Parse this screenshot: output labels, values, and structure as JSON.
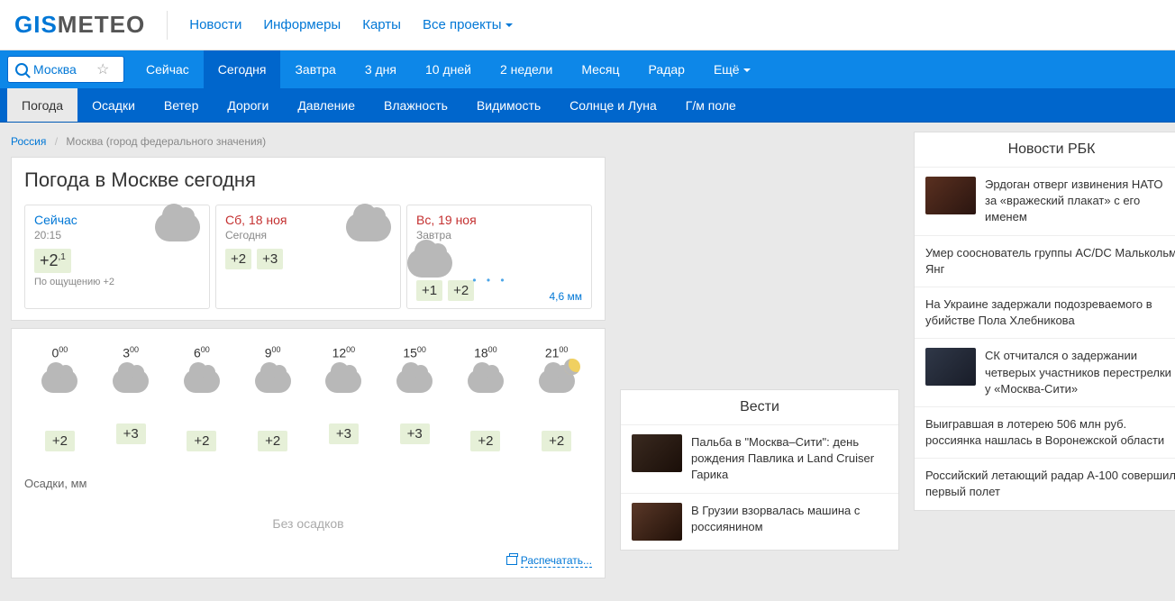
{
  "header": {
    "logo_gis": "GIS",
    "logo_meteo": "METEO",
    "nav": [
      "Новости",
      "Информеры",
      "Карты",
      "Все проекты"
    ]
  },
  "search": {
    "value": "Москва"
  },
  "nav_tabs": [
    "Сейчас",
    "Сегодня",
    "Завтра",
    "3 дня",
    "10 дней",
    "2 недели",
    "Месяц",
    "Радар",
    "Ещё"
  ],
  "nav_active": 1,
  "sub_nav": [
    "Погода",
    "Осадки",
    "Ветер",
    "Дороги",
    "Давление",
    "Влажность",
    "Видимость",
    "Солнце и Луна",
    "Г/м поле"
  ],
  "sub_nav_active": 0,
  "breadcrumb": {
    "country": "Россия",
    "city": "Москва (город федерального значения)"
  },
  "title": "Погода в Москве сегодня",
  "summary": [
    {
      "title": "Сейчас",
      "sub": "20:15",
      "temp": "+2",
      "temp_dec": ",1",
      "feel": "По ощущению +2"
    },
    {
      "title": "Сб, 18 ноя",
      "sub": "Сегодня",
      "temps": [
        "+2",
        "+3"
      ]
    },
    {
      "title": "Вс, 19 ноя",
      "sub": "Завтра",
      "temps": [
        "+1",
        "+2"
      ],
      "precip": "4,6 мм"
    }
  ],
  "hours": [
    {
      "h": "0",
      "m": "00",
      "temp": "+2"
    },
    {
      "h": "3",
      "m": "00",
      "temp": "+3"
    },
    {
      "h": "6",
      "m": "00",
      "temp": "+2"
    },
    {
      "h": "9",
      "m": "00",
      "temp": "+2"
    },
    {
      "h": "12",
      "m": "00",
      "temp": "+3"
    },
    {
      "h": "15",
      "m": "00",
      "temp": "+3"
    },
    {
      "h": "18",
      "m": "00",
      "temp": "+2"
    },
    {
      "h": "21",
      "m": "00",
      "temp": "+2"
    }
  ],
  "precip_label": "Осадки, мм",
  "precip_empty": "Без осадков",
  "print": "Распечатать...",
  "vesti": {
    "title": "Вести",
    "items": [
      "Пальба в \"Москва–Сити\": день рождения Павлика и Land Cruiser Гарика",
      "В Грузии взорвалась машина с россиянином"
    ]
  },
  "rbc": {
    "title": "Новости РБК",
    "items": [
      {
        "thumb": true,
        "text": "Эрдоган отверг извинения НАТО за «вражеский плакат» с его именем"
      },
      {
        "thumb": false,
        "text": "Умер сооснователь группы AC/DC Малькольм Янг"
      },
      {
        "thumb": false,
        "text": "На Украине задержали подозреваемого в убийстве Пола Хлебникова"
      },
      {
        "thumb": true,
        "text": "СК отчитался о задержании четверых участников перестрелки у «Москва-Сити»"
      },
      {
        "thumb": false,
        "text": "Выигравшая в лотерею 506 млн руб. россиянка нашлась в Воронежской области"
      },
      {
        "thumb": false,
        "text": "Российский летающий радар А-100 совершил первый полет"
      }
    ]
  }
}
